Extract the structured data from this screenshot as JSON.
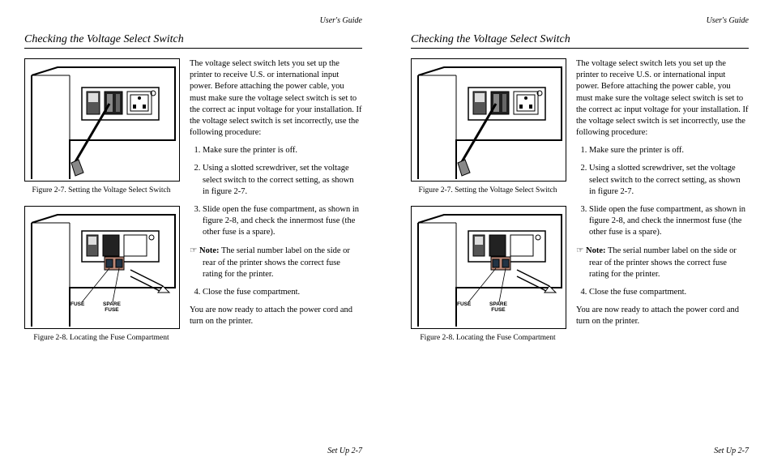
{
  "running_head": "User's Guide",
  "section_title": "Checking the Voltage Select Switch",
  "intro": "The voltage select switch lets you set up the printer to receive U.S. or international input power.  Before attaching the power cable, you must make sure the voltage select switch is set to the correct ac input voltage for your installation.  If the voltage select switch is set incorrectly, use the following procedure:",
  "steps": {
    "s1": "Make sure the printer is off.",
    "s2": "Using a slotted screwdriver, set the voltage select switch to the correct setting, as shown in figure 2-7.",
    "s3": "Slide open the fuse compartment, as shown in figure 2-8, and check the innermost fuse (the other fuse is a spare).",
    "s4": "Close the fuse compartment."
  },
  "note_icon": "☞",
  "note_label": "Note:",
  "note_text": "The serial number label on the side or rear of the printer shows the correct fuse rating for the printer.",
  "closing": "You are now ready to attach the power cord and turn on the printer.",
  "fig1_caption": "Figure 2-7.  Setting the Voltage Select Switch",
  "fig2_caption": "Figure 2-8.  Locating the Fuse Compartment",
  "fuse_label": "FUSE",
  "spare_fuse_label": "SPARE\nFUSE",
  "footer": "Set Up  2-7"
}
